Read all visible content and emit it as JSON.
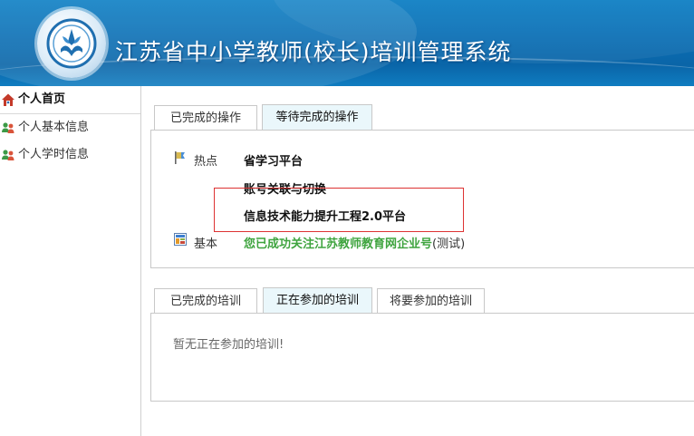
{
  "header": {
    "title": "江苏省中小学教师(校长)培训管理系统",
    "logo_icon": "jiangsu-teacher-training-logo",
    "colors": {
      "primary": "#0b70b6"
    }
  },
  "sidebar": {
    "items": [
      {
        "label": "个人首页",
        "icon": "home-icon",
        "active": true
      },
      {
        "label": "个人基本信息",
        "icon": "users-icon",
        "active": false
      },
      {
        "label": "个人学时信息",
        "icon": "users-icon",
        "active": false
      }
    ]
  },
  "operations": {
    "tabs": [
      {
        "label": "已完成的操作",
        "selected": false
      },
      {
        "label": "等待完成的操作",
        "selected": true
      }
    ],
    "hot": {
      "label": "热点",
      "links": [
        "省学习平台",
        "账号关联与切换",
        "信息技术能力提升工程2.0平台"
      ]
    },
    "basic": {
      "label": "基本",
      "notice_main": "您已成功关注江苏教师教育网企业号",
      "notice_suffix": "(测试)"
    }
  },
  "trainings": {
    "tabs": [
      {
        "label": "已完成的培训",
        "selected": false
      },
      {
        "label": "正在参加的培训",
        "selected": true
      },
      {
        "label": "将要参加的培训",
        "selected": false
      }
    ],
    "empty_message": "暂无正在参加的培训!"
  }
}
